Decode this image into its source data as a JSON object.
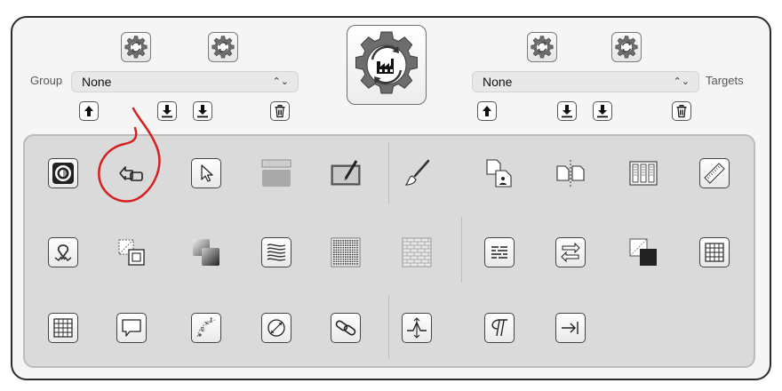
{
  "left_panel": {
    "label": "Group",
    "select_value": "None"
  },
  "right_panel": {
    "label": "Targets",
    "select_value": "None"
  },
  "icons": {
    "gear": "gear-arrows-icon",
    "factory": "factory-gear-icon",
    "up": "arrow-up-icon",
    "down": "arrow-down-to-line-icon",
    "trash": "trash-icon",
    "chevron": "chevron-up-down-icon"
  },
  "tools": [
    "circle-target-tool",
    "back-arrow-box-tool",
    "pointer-arrow-tool",
    "keyboard-strip-tool",
    "tablet-pen-tool",
    "paintbrush-tool",
    "document-user-tool",
    "split-document-tool",
    "columns-tool",
    "ruler-tool",
    "ribbon-tool",
    "dashed-square-tool",
    "overlap-squares-tool",
    "stacked-waves-tool",
    "dot-pattern-tool",
    "brick-pattern-tool",
    "text-lines-tool",
    "swap-arrows-tool",
    "corner-fill-tool",
    "grid-tool",
    "grid-table-tool",
    "speech-bubble-tool",
    "text-on-path-tool",
    "circle-diagonal-tool",
    "link-chain-tool",
    "baseline-shift-tool",
    "paragraph-tool",
    "tab-arrow-tool"
  ],
  "colors": {
    "annotation": "#d62020",
    "palette_bg": "#dadada",
    "window_border": "#2a2a2a"
  }
}
